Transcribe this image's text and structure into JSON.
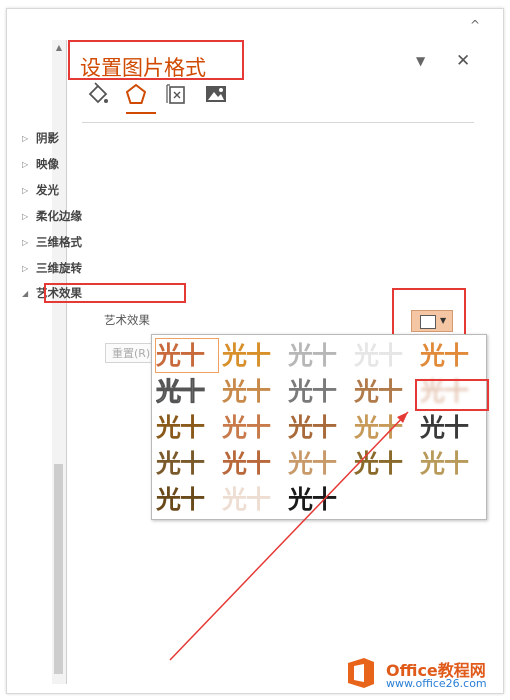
{
  "pane": {
    "title": "设置图片格式",
    "menu_icon": "chevron-down-icon",
    "close_label": "✕"
  },
  "collapse_label": "^",
  "tabs": [
    {
      "name": "fill-line-icon"
    },
    {
      "name": "effects-icon",
      "active": true
    },
    {
      "name": "size-properties-icon"
    },
    {
      "name": "picture-icon"
    }
  ],
  "sections": [
    {
      "label": "阴影",
      "expanded": false
    },
    {
      "label": "映像",
      "expanded": false
    },
    {
      "label": "发光",
      "expanded": false
    },
    {
      "label": "柔化边缘",
      "expanded": false
    },
    {
      "label": "三维格式",
      "expanded": false
    },
    {
      "label": "三维旋转",
      "expanded": false
    },
    {
      "label": "艺术效果",
      "expanded": true
    }
  ],
  "artistic": {
    "label": "艺术效果",
    "reset_label": "重置(R)"
  },
  "gallery": {
    "thumb_text": "光十",
    "rows": [
      [
        {
          "color": "#c86a3c",
          "style": "normal",
          "selected": true
        },
        {
          "color": "#d8902a",
          "style": "normal"
        },
        {
          "color": "#9a9a9a",
          "style": "light"
        },
        {
          "color": "#dcdcdc",
          "style": "light"
        },
        {
          "color": "#e08a3a",
          "style": "normal"
        }
      ],
      [
        {
          "color": "#555555",
          "style": "outline"
        },
        {
          "color": "#c88a4a",
          "style": "normal"
        },
        {
          "color": "#7a7a7a",
          "style": "normal"
        },
        {
          "color": "#b07a4a",
          "style": "normal"
        },
        {
          "color": "#e7c8b8",
          "style": "blur"
        }
      ],
      [
        {
          "color": "#8a5a1a",
          "style": "normal"
        },
        {
          "color": "#c87a4a",
          "style": "normal"
        },
        {
          "color": "#a86a3a",
          "style": "normal"
        },
        {
          "color": "#c89a5a",
          "style": "normal"
        },
        {
          "color": "#3a3a3a",
          "style": "normal"
        }
      ],
      [
        {
          "color": "#7a5a2a",
          "style": "normal"
        },
        {
          "color": "#b8683a",
          "style": "normal"
        },
        {
          "color": "#c89a6a",
          "style": "normal"
        },
        {
          "color": "#8a6a2a",
          "style": "normal"
        },
        {
          "color": "#b89a5a",
          "style": "normal"
        }
      ],
      [
        {
          "color": "#6a4a1a",
          "style": "normal"
        },
        {
          "color": "#e8d0c0",
          "style": "light"
        },
        {
          "color": "#1a1a1a",
          "style": "normal"
        }
      ]
    ]
  },
  "watermark": {
    "name": "Office教程网",
    "url": "www.office26.com"
  },
  "colors": {
    "accent": "#d04a02",
    "highlight_box": "#e53935"
  }
}
